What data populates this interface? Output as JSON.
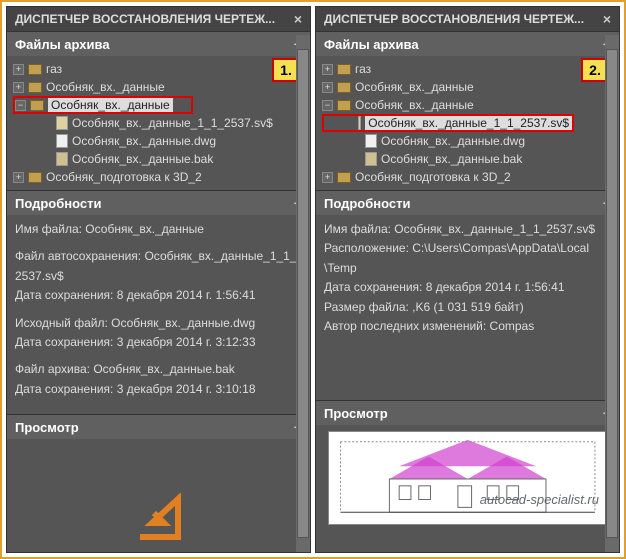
{
  "window_title": "ДИСПЕТЧЕР ВОССТАНОВЛЕНИЯ ЧЕРТЕЖ...",
  "sections": {
    "archive": "Файлы архива",
    "details": "Подробности",
    "preview": "Просмотр"
  },
  "left": {
    "badge": "1.",
    "tree": {
      "node1": "газ",
      "node2": "Особняк_вх._данные",
      "node3_sel": "Особняк_вх._данные",
      "file1": "Особняк_вх._данные_1_1_2537.sv$",
      "file2": "Особняк_вх._данные.dwg",
      "file3": "Особняк_вх._данные.bak",
      "node4": "Особняк_подготовка к 3D_2"
    },
    "details": {
      "l1": "Имя файла: Особняк_вх._данные",
      "l2a": "Файл автосохранения: Особняк_вх._данные_1_1_",
      "l2b": "2537.sv$",
      "l3": "Дата сохранения: 8 декабря 2014 г.  1:56:41",
      "l4": "Исходный файл: Особняк_вх._данные.dwg",
      "l5": "Дата сохранения: 3 декабря 2014 г.  3:12:33",
      "l6": "Файл архива: Особняк_вх._данные.bak",
      "l7": "Дата сохранения: 3 декабря 2014 г.  3:10:18"
    }
  },
  "right": {
    "badge": "2.",
    "tree": {
      "node1": "газ",
      "node2": "Особняк_вх._данные",
      "node3": "Особняк_вх._данные",
      "file1_sel": "Особняк_вх._данные_1_1_2537.sv$",
      "file2": "Особняк_вх._данные.dwg",
      "file3": "Особняк_вх._данные.bak",
      "node4": "Особняк_подготовка к 3D_2"
    },
    "details": {
      "l1": "Имя файла: Особняк_вх._данные_1_1_2537.sv$",
      "l2a": "Расположение: C:\\Users\\Compas\\AppData\\Local",
      "l2b": "\\Temp",
      "l3": "Дата сохранения: 8 декабря 2014 г.  1:56:41",
      "l4": "Размер файла: ,K6 (1 031 519 байт)",
      "l5": "Автор последних изменений: Compas"
    }
  },
  "watermark": "autocad-specialist.ru"
}
